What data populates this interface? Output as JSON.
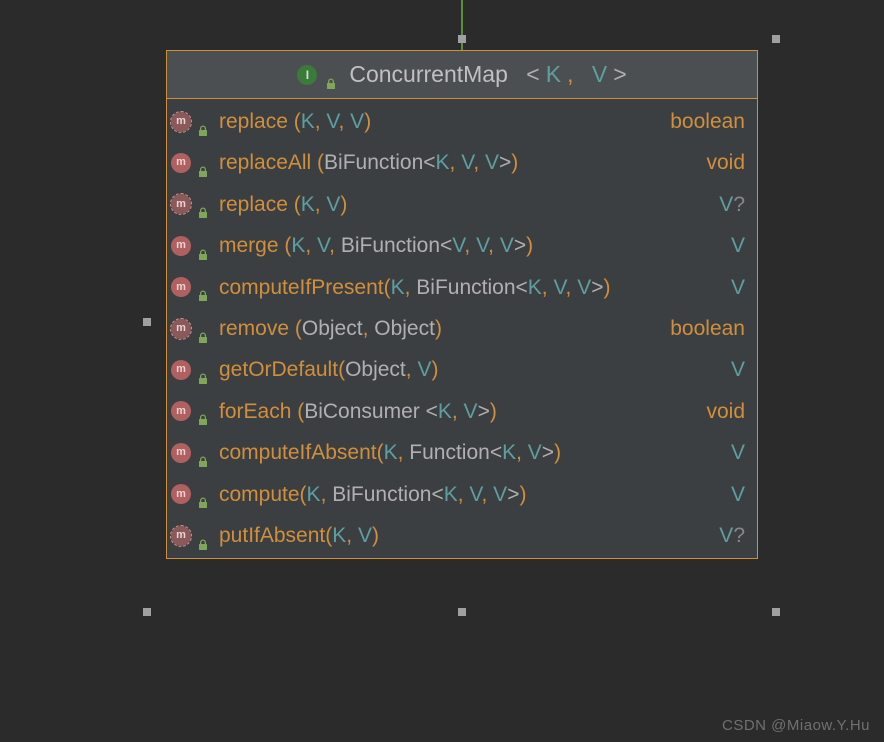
{
  "header": {
    "interface_badge": "I",
    "class_name": "ConcurrentMap",
    "generics_open": "<",
    "type_K": "K",
    "sep": ",",
    "type_V": "V",
    "generics_close": ">"
  },
  "methods": [
    {
      "abstract": true,
      "sig": [
        {
          "k": "name",
          "t": "replace"
        },
        {
          "k": "paren",
          "t": " ("
        },
        {
          "k": "type",
          "t": "K"
        },
        {
          "k": "comma",
          "t": ", "
        },
        {
          "k": "type",
          "t": "V"
        },
        {
          "k": "comma",
          "t": ", "
        },
        {
          "k": "type",
          "t": "V"
        },
        {
          "k": "paren",
          "t": ")"
        }
      ],
      "ret": [
        {
          "k": "name",
          "t": "boolean"
        }
      ]
    },
    {
      "abstract": false,
      "sig": [
        {
          "k": "name",
          "t": "replaceAll"
        },
        {
          "k": "paren",
          "t": " ("
        },
        {
          "k": "plain",
          "t": "BiFunction"
        },
        {
          "k": "angle",
          "t": "<"
        },
        {
          "k": "type",
          "t": "K"
        },
        {
          "k": "comma",
          "t": ", "
        },
        {
          "k": "type",
          "t": "V"
        },
        {
          "k": "comma",
          "t": ", "
        },
        {
          "k": "type",
          "t": "V"
        },
        {
          "k": "angle",
          "t": ">"
        },
        {
          "k": "paren",
          "t": ")"
        }
      ],
      "ret": [
        {
          "k": "name",
          "t": "void"
        }
      ]
    },
    {
      "abstract": true,
      "sig": [
        {
          "k": "name",
          "t": "replace"
        },
        {
          "k": "paren",
          "t": " ("
        },
        {
          "k": "type",
          "t": "K"
        },
        {
          "k": "comma",
          "t": ", "
        },
        {
          "k": "type",
          "t": "V"
        },
        {
          "k": "paren",
          "t": ")"
        }
      ],
      "ret": [
        {
          "k": "type",
          "t": "V"
        },
        {
          "k": "q",
          "t": "?"
        }
      ]
    },
    {
      "abstract": false,
      "sig": [
        {
          "k": "name",
          "t": "merge"
        },
        {
          "k": "paren",
          "t": " ("
        },
        {
          "k": "type",
          "t": "K"
        },
        {
          "k": "comma",
          "t": ", "
        },
        {
          "k": "type",
          "t": "V"
        },
        {
          "k": "comma",
          "t": ", "
        },
        {
          "k": "plain",
          "t": "BiFunction"
        },
        {
          "k": "angle",
          "t": "<"
        },
        {
          "k": "type",
          "t": "V"
        },
        {
          "k": "comma",
          "t": ", "
        },
        {
          "k": "type",
          "t": "V"
        },
        {
          "k": "comma",
          "t": ", "
        },
        {
          "k": "type",
          "t": "V"
        },
        {
          "k": "angle",
          "t": ">"
        },
        {
          "k": "paren",
          "t": ")"
        }
      ],
      "ret": [
        {
          "k": "type",
          "t": "V"
        }
      ]
    },
    {
      "abstract": false,
      "sig": [
        {
          "k": "name",
          "t": "computeIfPresent"
        },
        {
          "k": "paren",
          "t": "("
        },
        {
          "k": "type",
          "t": "K"
        },
        {
          "k": "comma",
          "t": ", "
        },
        {
          "k": "plain",
          "t": "BiFunction"
        },
        {
          "k": "angle",
          "t": "<"
        },
        {
          "k": "type",
          "t": "K"
        },
        {
          "k": "comma",
          "t": ", "
        },
        {
          "k": "type",
          "t": "V"
        },
        {
          "k": "comma",
          "t": ", "
        },
        {
          "k": "type",
          "t": "V"
        },
        {
          "k": "angle",
          "t": ">"
        },
        {
          "k": "paren",
          "t": ")"
        }
      ],
      "ret": [
        {
          "k": "type",
          "t": "V"
        }
      ]
    },
    {
      "abstract": true,
      "sig": [
        {
          "k": "name",
          "t": "remove"
        },
        {
          "k": "paren",
          "t": " ("
        },
        {
          "k": "plain",
          "t": "Object"
        },
        {
          "k": "comma",
          "t": ", "
        },
        {
          "k": "plain",
          "t": "Object"
        },
        {
          "k": "paren",
          "t": ")"
        }
      ],
      "ret": [
        {
          "k": "name",
          "t": "boolean"
        }
      ]
    },
    {
      "abstract": false,
      "sig": [
        {
          "k": "name",
          "t": "getOrDefault"
        },
        {
          "k": "paren",
          "t": "("
        },
        {
          "k": "plain",
          "t": "Object"
        },
        {
          "k": "comma",
          "t": ", "
        },
        {
          "k": "type",
          "t": "V"
        },
        {
          "k": "paren",
          "t": ")"
        }
      ],
      "ret": [
        {
          "k": "type",
          "t": "V"
        }
      ]
    },
    {
      "abstract": false,
      "sig": [
        {
          "k": "name",
          "t": "forEach"
        },
        {
          "k": "paren",
          "t": " ("
        },
        {
          "k": "plain",
          "t": "BiConsumer"
        },
        {
          "k": "angle",
          "t": " <"
        },
        {
          "k": "type",
          "t": "K"
        },
        {
          "k": "comma",
          "t": ", "
        },
        {
          "k": "type",
          "t": "V"
        },
        {
          "k": "angle",
          "t": ">"
        },
        {
          "k": "paren",
          "t": ")"
        }
      ],
      "ret": [
        {
          "k": "name",
          "t": "void"
        }
      ]
    },
    {
      "abstract": false,
      "sig": [
        {
          "k": "name",
          "t": "computeIfAbsent"
        },
        {
          "k": "paren",
          "t": "("
        },
        {
          "k": "type",
          "t": "K"
        },
        {
          "k": "comma",
          "t": ", "
        },
        {
          "k": "plain",
          "t": "Function"
        },
        {
          "k": "angle",
          "t": "<"
        },
        {
          "k": "type",
          "t": "K"
        },
        {
          "k": "comma",
          "t": ", "
        },
        {
          "k": "type",
          "t": "V"
        },
        {
          "k": "angle",
          "t": ">"
        },
        {
          "k": "paren",
          "t": ")"
        }
      ],
      "ret": [
        {
          "k": "type",
          "t": "V"
        }
      ]
    },
    {
      "abstract": false,
      "sig": [
        {
          "k": "name",
          "t": "compute"
        },
        {
          "k": "paren",
          "t": "("
        },
        {
          "k": "type",
          "t": "K"
        },
        {
          "k": "comma",
          "t": ", "
        },
        {
          "k": "plain",
          "t": "BiFunction"
        },
        {
          "k": "angle",
          "t": "<"
        },
        {
          "k": "type",
          "t": "K"
        },
        {
          "k": "comma",
          "t": ", "
        },
        {
          "k": "type",
          "t": "V"
        },
        {
          "k": "comma",
          "t": ", "
        },
        {
          "k": "type",
          "t": "V"
        },
        {
          "k": "angle",
          "t": ">"
        },
        {
          "k": "paren",
          "t": ")"
        }
      ],
      "ret": [
        {
          "k": "type",
          "t": "V"
        }
      ]
    },
    {
      "abstract": true,
      "sig": [
        {
          "k": "name",
          "t": "putIfAbsent"
        },
        {
          "k": "paren",
          "t": "("
        },
        {
          "k": "type",
          "t": "K"
        },
        {
          "k": "comma",
          "t": ", "
        },
        {
          "k": "type",
          "t": "V"
        },
        {
          "k": "paren",
          "t": ")"
        }
      ],
      "ret": [
        {
          "k": "type",
          "t": "V"
        },
        {
          "k": "q",
          "t": "?"
        }
      ]
    }
  ],
  "watermark": "CSDN @Miaow.Y.Hu"
}
